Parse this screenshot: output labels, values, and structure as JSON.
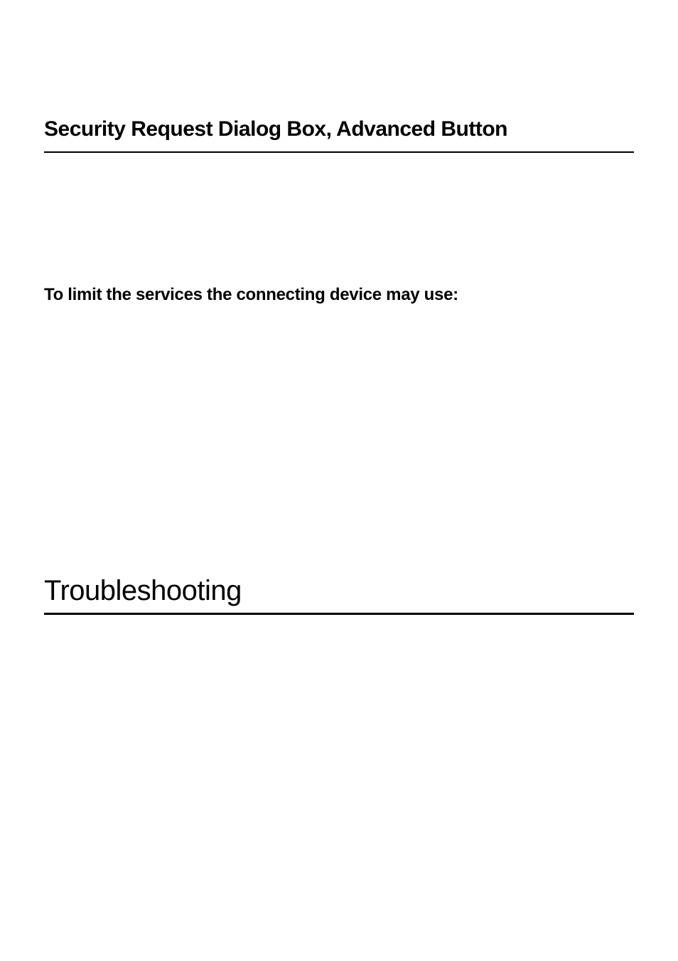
{
  "section": {
    "heading": "Security Request Dialog Box, Advanced Button",
    "subheading": "To limit the services the connecting device may use:"
  },
  "main_heading": "Troubleshooting"
}
